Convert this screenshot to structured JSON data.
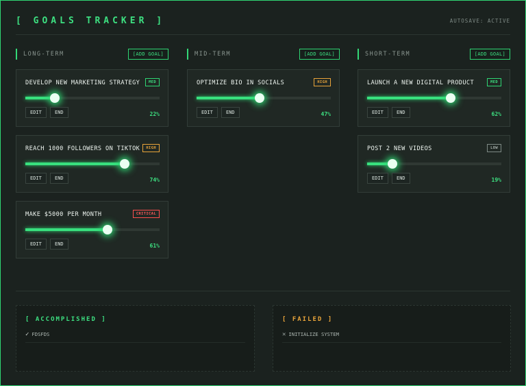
{
  "header": {
    "title": "[ GOALS TRACKER ]",
    "autosave": "AUTOSAVE: ACTIVE"
  },
  "columns": [
    {
      "title": "LONG-TERM",
      "add_label": "[ADD GOAL]",
      "goals": [
        {
          "title": "DEVELOP NEW MARKETING STRATEGY",
          "priority": "MED",
          "progress": 22,
          "percent_label": "22%",
          "edit_label": "EDIT",
          "end_label": "END"
        },
        {
          "title": "REACH 1000 FOLLOWERS ON TIKTOK",
          "priority": "HIGH",
          "progress": 74,
          "percent_label": "74%",
          "edit_label": "EDIT",
          "end_label": "END"
        },
        {
          "title": "MAKE $5000 PER MONTH",
          "priority": "CRITICAL",
          "progress": 61,
          "percent_label": "61%",
          "edit_label": "EDIT",
          "end_label": "END"
        }
      ]
    },
    {
      "title": "MID-TERM",
      "add_label": "[ADD GOAL]",
      "goals": [
        {
          "title": "OPTIMIZE BIO IN SOCIALS",
          "priority": "HIGH",
          "progress": 47,
          "percent_label": "47%",
          "edit_label": "EDIT",
          "end_label": "END"
        }
      ]
    },
    {
      "title": "SHORT-TERM",
      "add_label": "[ADD GOAL]",
      "goals": [
        {
          "title": "LAUNCH A NEW DIGITAL PRODUCT",
          "priority": "MED",
          "progress": 62,
          "percent_label": "62%",
          "edit_label": "EDIT",
          "end_label": "END"
        },
        {
          "title": "POST 2 NEW VIDEOS",
          "priority": "LOW",
          "progress": 19,
          "percent_label": "19%",
          "edit_label": "EDIT",
          "end_label": "END"
        }
      ]
    }
  ],
  "accomplished": {
    "title": "[ ACCOMPLISHED ]",
    "items": [
      {
        "mark": "✓",
        "text": "FDSFDS"
      }
    ]
  },
  "failed": {
    "title": "[ FAILED ]",
    "items": [
      {
        "mark": "✕",
        "text": "INITIALIZE SYSTEM"
      }
    ]
  },
  "colors": {
    "accent": "#3de081",
    "warning": "#e9a43a",
    "danger": "#ff5a5a",
    "background": "#1b221f"
  },
  "icons": {
    "check": "check-icon",
    "cross": "close-icon"
  }
}
